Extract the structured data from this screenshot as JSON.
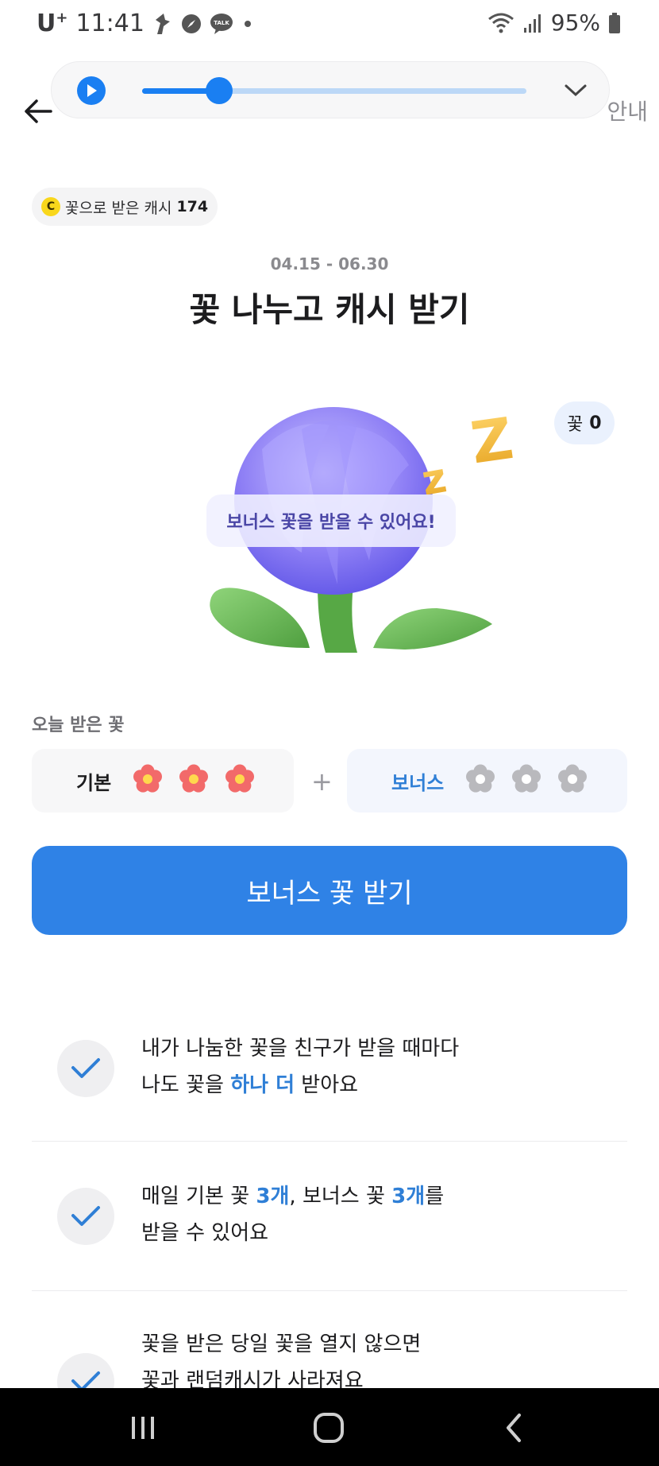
{
  "status_bar": {
    "carrier": "U",
    "carrier_sup": "+",
    "time": "11:41",
    "battery": "95%",
    "talk_badge": "TALK"
  },
  "player": {
    "progress_fraction": 0.2
  },
  "header": {
    "guide_label": "안내"
  },
  "cash_chip": {
    "coin_symbol": "C",
    "label": "꽃으로 받은 캐시",
    "value": "174"
  },
  "event": {
    "period": "04.15 - 06.30",
    "title": "꽃 나누고 캐시 받기",
    "flower_label": "꽃",
    "flower_count": "0",
    "bubble_text": "보너스 꽃을 받을 수 있어요!"
  },
  "today": {
    "label": "오늘 받은 꽃",
    "basic_label": "기본",
    "basic_received": 3,
    "basic_total": 3,
    "plus": "+",
    "bonus_label": "보너스",
    "bonus_received": 0,
    "bonus_total": 3
  },
  "cta_label": "보너스 꽃 받기",
  "info": [
    {
      "line1": "내가 나눔한 꽃을 친구가 받을 때마다",
      "line2_pre": "나도 꽃을 ",
      "line2_hl": "하나 더",
      "line2_post": " 받아요"
    },
    {
      "line1_pre": "매일 기본 꽃 ",
      "line1_hl1": "3개",
      "line1_mid": ", 보너스 꽃 ",
      "line1_hl2": "3개",
      "line1_post": "를",
      "line2": "받을 수 있어요"
    },
    {
      "line1": "꽃을 받은 당일 꽃을 열지 않으면",
      "line2": "꽃과 랜덤캐시가 사라져요"
    }
  ],
  "colors": {
    "accent": "#2f82e6",
    "highlight": "#2f7fd6",
    "flower_active": "#f26a6a",
    "flower_center": "#ffd84d",
    "flower_inactive": "#b9b9bd"
  }
}
